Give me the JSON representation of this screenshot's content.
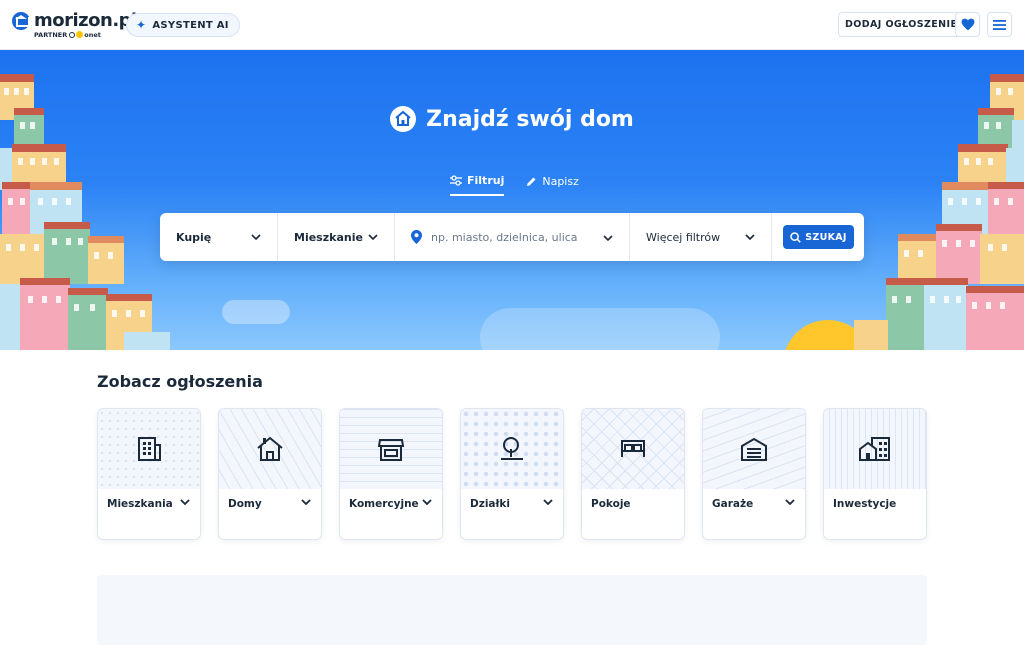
{
  "header": {
    "logo_text": "morizon.pl",
    "partner_prefix": "PARTNER",
    "partner_name": "onet",
    "ai_label": "ASYSTENT AI",
    "add_label": "DODAJ OGŁOSZENIE",
    "icons": {
      "logo": "house-logo-icon",
      "ai": "sparkle-icon",
      "favorites": "heart-icon",
      "menu": "hamburger-menu-icon"
    }
  },
  "hero": {
    "title": "Znajdź swój dom",
    "tabs": [
      {
        "label": "Filtruj",
        "icon": "sliders-icon",
        "active": true
      },
      {
        "label": "Napisz",
        "icon": "pencil-icon",
        "active": false
      }
    ],
    "search": {
      "transaction": "Kupię",
      "property_type": "Mieszkanie",
      "location_placeholder": "np. miasto, dzielnica, ulica",
      "more_filters": "Więcej filtrów",
      "search_label": "SZUKAJ"
    }
  },
  "listings": {
    "title": "Zobacz ogłoszenia",
    "categories": [
      {
        "label": "Mieszkania",
        "icon": "apartment-building-icon",
        "has_dropdown": true
      },
      {
        "label": "Domy",
        "icon": "house-icon",
        "has_dropdown": true
      },
      {
        "label": "Komercyjne",
        "icon": "storefront-icon",
        "has_dropdown": true
      },
      {
        "label": "Działki",
        "icon": "tree-plot-icon",
        "has_dropdown": true
      },
      {
        "label": "Pokoje",
        "icon": "bed-icon",
        "has_dropdown": false
      },
      {
        "label": "Garaże",
        "icon": "garage-icon",
        "has_dropdown": true
      },
      {
        "label": "Inwestycje",
        "icon": "buildings-icon",
        "has_dropdown": false
      }
    ]
  },
  "colors": {
    "primary": "#1866d6",
    "hero_top": "#1d72f0",
    "hero_bottom": "#8cc8fd",
    "text": "#1b2a3a",
    "sun": "#ffc72c"
  }
}
